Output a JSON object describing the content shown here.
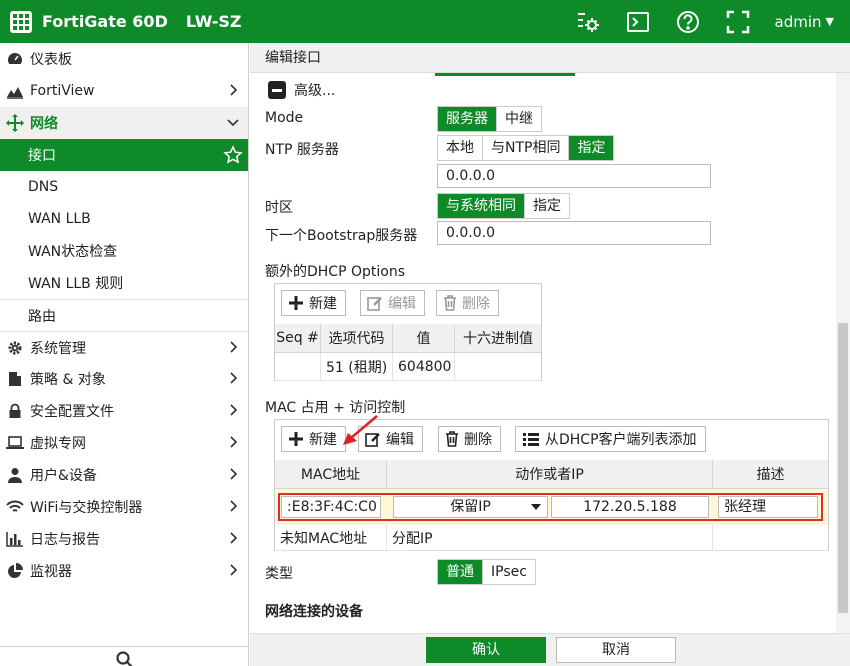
{
  "topbar": {
    "brand": "FortiGate 60D",
    "hostname": "LW-SZ",
    "user": "admin"
  },
  "sidebar": {
    "items": [
      {
        "label": "仪表板"
      },
      {
        "label": "FortiView"
      },
      {
        "label": "网络"
      },
      {
        "label": "接口"
      },
      {
        "label": "DNS"
      },
      {
        "label": "WAN LLB"
      },
      {
        "label": "WAN状态检查"
      },
      {
        "label": "WAN LLB 规则"
      },
      {
        "label": "路由"
      },
      {
        "label": "系统管理"
      },
      {
        "label": "策略 & 对象"
      },
      {
        "label": "安全配置文件"
      },
      {
        "label": "虚拟专网"
      },
      {
        "label": "用户&设备"
      },
      {
        "label": "WiFi与交换控制器"
      },
      {
        "label": "日志与报告"
      },
      {
        "label": "监视器"
      }
    ]
  },
  "main": {
    "title": "编辑接口",
    "advanced_label": "高级...",
    "mode": {
      "label": "Mode",
      "options": [
        "服务器",
        "中继"
      ]
    },
    "ntp": {
      "label": "NTP 服务器",
      "options": [
        "本地",
        "与NTP相同",
        "指定"
      ],
      "value": "0.0.0.0"
    },
    "timezone": {
      "label": "时区",
      "options": [
        "与系统相同",
        "指定"
      ]
    },
    "bootstrap": {
      "label": "下一个Bootstrap服务器",
      "value": "0.0.0.0"
    },
    "dhcp_options": {
      "label": "额外的DHCP Options",
      "buttons": [
        "新建",
        "编辑",
        "删除"
      ],
      "columns": [
        "Seq #",
        "选项代码",
        "值",
        "十六进制值"
      ],
      "rows": [
        {
          "seq": "",
          "code": "51 (租期)",
          "value": "604800",
          "hex": ""
        }
      ]
    },
    "mac_control": {
      "label": "MAC 占用 + 访问控制",
      "buttons": [
        "新建",
        "编辑",
        "删除",
        "从DHCP客户端列表添加"
      ],
      "columns": [
        "MAC地址",
        "动作或者IP",
        "描述"
      ],
      "edit_row": {
        "mac": ":E8:3F:4C:C0",
        "action": "保留IP",
        "ip": "172.20.5.188",
        "desc": "张经理"
      },
      "unknown_row": {
        "mac": "未知MAC地址",
        "action": "分配IP"
      }
    },
    "type": {
      "label": "类型",
      "options": [
        "普通",
        "IPsec"
      ]
    },
    "connected_devices_label": "网络连接的设备"
  },
  "footer": {
    "ok": "确认",
    "cancel": "取消"
  }
}
